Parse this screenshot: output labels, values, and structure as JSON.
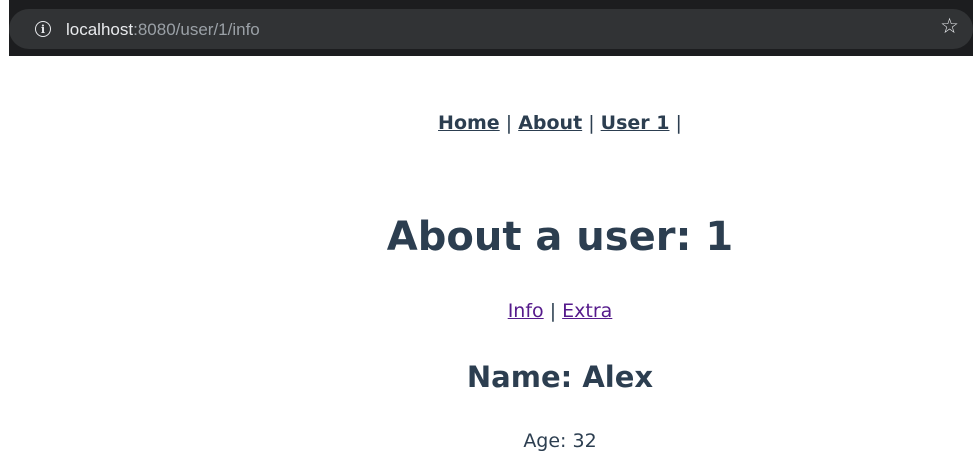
{
  "browser": {
    "url_host": "localhost",
    "url_path": ":8080/user/1/info",
    "info_icon": "info-icon",
    "bookmark_icon": "star-icon"
  },
  "nav": {
    "items": [
      {
        "label": "Home"
      },
      {
        "label": "About"
      },
      {
        "label": "User 1"
      }
    ],
    "separator": "|"
  },
  "page": {
    "title": "About a user: 1"
  },
  "subnav": {
    "items": [
      {
        "label": "Info"
      },
      {
        "label": "Extra"
      }
    ],
    "separator": "|"
  },
  "user": {
    "name_line": "Name: Alex",
    "age_line": "Age: 32"
  },
  "colors": {
    "text": "#2c3e50",
    "visited_link": "#551a8b",
    "browser_bg": "#1c1d1f",
    "omnibox_bg": "#313335"
  }
}
